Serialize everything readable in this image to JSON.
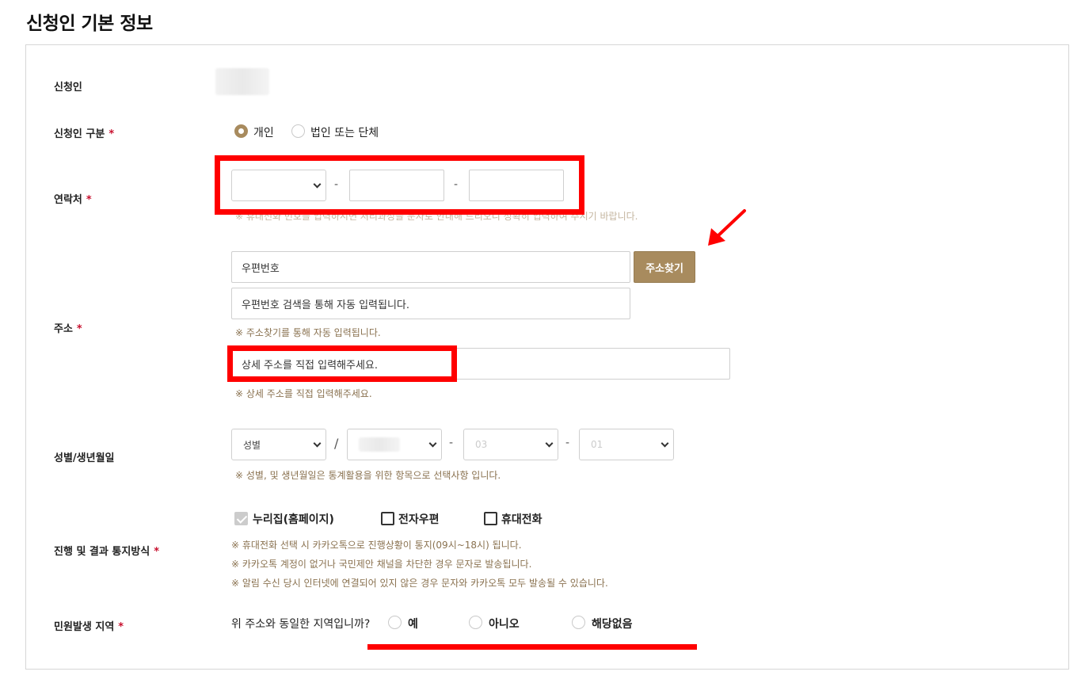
{
  "page_title": "신청인 기본 정보",
  "fields": {
    "applicant": {
      "label": "신청인"
    },
    "applicant_type": {
      "label": "신청인 구분",
      "required_mark": "*",
      "options": [
        "개인",
        "법인 또는 단체"
      ],
      "selected": "개인"
    },
    "contact": {
      "label": "연락처",
      "required_mark": "*",
      "separator": "-",
      "hint": "※ 휴대전화 번호를 입력하시면 처리과정을 문자로 안내해 드리오니 정확히 입력하여 주시기 바랍니다."
    },
    "address": {
      "label": "주소",
      "required_mark": "*",
      "zipcode_placeholder": "우편번호",
      "search_button": "주소찾기",
      "base_address_placeholder": "우편번호 검색을 통해 자동 입력됩니다.",
      "base_hint": "※ 주소찾기를 통해 자동 입력됩니다.",
      "detail_placeholder": "상세 주소를 직접 입력해주세요.",
      "detail_hint": "※ 상세 주소를 직접 입력해주세요."
    },
    "gender_birth": {
      "label": "성별/생년월일",
      "gender_default": "성별",
      "slash": "/",
      "separator": "-",
      "month_value": "03",
      "day_value": "01",
      "hint": "※ 성별, 및 생년월일은 통계활용을 위한 항목으로 선택사항 입니다."
    },
    "notify": {
      "label": "진행 및 결과 통지방식",
      "required_mark": "*",
      "options": [
        "누리집(홈페이지)",
        "전자우편",
        "휴대전화"
      ],
      "hints": [
        "※ 휴대전화 선택 시 카카오톡으로 진행상황이 통지(09시~18시) 됩니다.",
        "※ 카카오톡 계정이 없거나 국민제안 채널을 차단한 경우 문자로 발송됩니다.",
        "※ 알림 수신 당시 인터넷에 연결되어 있지 않은 경우 문자와 카카오톡 모두 발송될 수 있습니다."
      ]
    },
    "region": {
      "label": "민원발생 지역",
      "required_mark": "*",
      "question": "위 주소와 동일한 지역입니까?",
      "options": [
        "예",
        "아니오",
        "해당없음"
      ]
    }
  },
  "colors": {
    "accent": "#a88b5e",
    "hint": "#8a7250",
    "required": "#c8102e",
    "annotation": "#ff0000"
  }
}
